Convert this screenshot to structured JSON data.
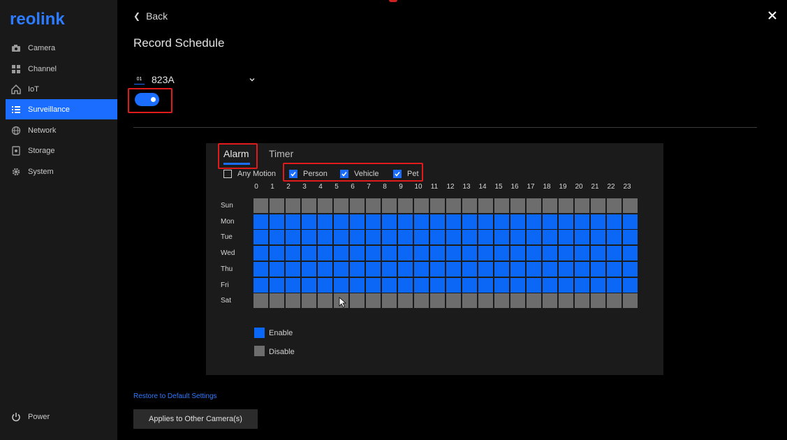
{
  "brand": {
    "logo_text": "reolink",
    "accent": "#1a6dff"
  },
  "sidebar": {
    "items": [
      {
        "label": "Camera",
        "icon": "camera-icon",
        "active": false
      },
      {
        "label": "Channel",
        "icon": "grid-icon",
        "active": false
      },
      {
        "label": "IoT",
        "icon": "home-icon",
        "active": false
      },
      {
        "label": "Surveillance",
        "icon": "list-icon",
        "active": true
      },
      {
        "label": "Network",
        "icon": "globe-icon",
        "active": false
      },
      {
        "label": "Storage",
        "icon": "storage-icon",
        "active": false
      },
      {
        "label": "System",
        "icon": "gear-icon",
        "active": false
      }
    ],
    "power_label": "Power"
  },
  "header": {
    "back_label": "Back",
    "title": "Record Schedule"
  },
  "camera": {
    "badge": "01",
    "name": "823A",
    "enabled": true
  },
  "tabs": {
    "alarm": "Alarm",
    "timer": "Timer",
    "active": "Alarm"
  },
  "triggers": [
    {
      "label": "Any Motion",
      "checked": false
    },
    {
      "label": "Person",
      "checked": true
    },
    {
      "label": "Vehicle",
      "checked": true
    },
    {
      "label": "Pet",
      "checked": true
    }
  ],
  "schedule": {
    "hours": [
      "0",
      "1",
      "2",
      "3",
      "4",
      "5",
      "6",
      "7",
      "8",
      "9",
      "10",
      "11",
      "12",
      "13",
      "14",
      "15",
      "16",
      "17",
      "18",
      "19",
      "20",
      "21",
      "22",
      "23"
    ],
    "days": [
      {
        "label": "Sun",
        "enabled": false
      },
      {
        "label": "Mon",
        "enabled": true
      },
      {
        "label": "Tue",
        "enabled": true
      },
      {
        "label": "Wed",
        "enabled": true
      },
      {
        "label": "Thu",
        "enabled": true
      },
      {
        "label": "Fri",
        "enabled": true
      },
      {
        "label": "Sat",
        "enabled": false
      }
    ],
    "enable_color": "#0b67f5",
    "disable_color": "#6d6d6d"
  },
  "legend": {
    "enable": "Enable",
    "disable": "Disable"
  },
  "footer": {
    "restore_label": "Restore to Default Settings",
    "apply_label": "Applies to Other Camera(s)"
  }
}
